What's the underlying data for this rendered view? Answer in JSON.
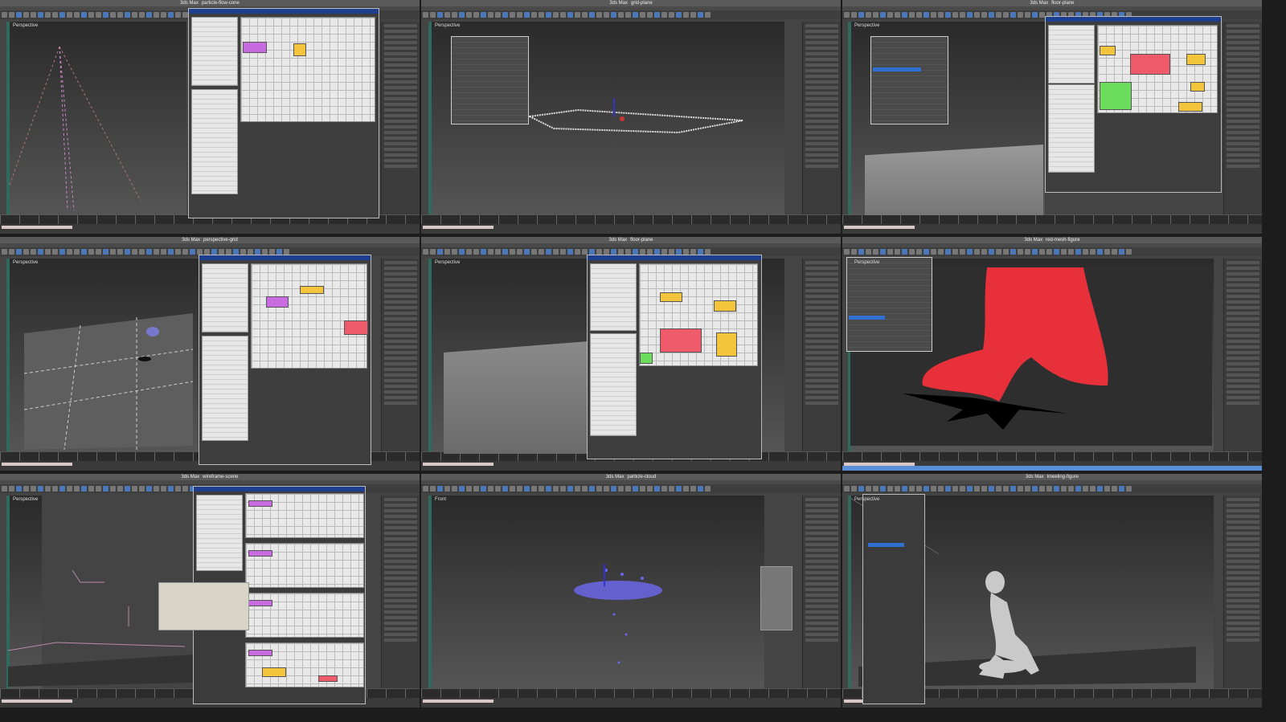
{
  "app": {
    "name": "3ds Max"
  },
  "grid": {
    "columns": 3,
    "rows": 3
  },
  "colors": {
    "viewport_top": "#2a2a2a",
    "viewport_bottom": "#555555",
    "node_purple": "#c86be0",
    "node_yellow": "#f2c53d",
    "node_red": "#ee5a6a",
    "node_green": "#6bdc5c",
    "mesh_red": "#e8303a",
    "particles_blue": "#6b66e8",
    "figure_gray": "#c9c9c9"
  },
  "tiles": [
    {
      "view": "Perspective",
      "content": "particle-flow-cone"
    },
    {
      "view": "Perspective",
      "content": "grid-plane"
    },
    {
      "view": "Perspective",
      "content": "floor-plane"
    },
    {
      "view": "Perspective",
      "content": "perspective-grid"
    },
    {
      "view": "Perspective",
      "content": "floor-plane"
    },
    {
      "view": "Perspective",
      "content": "red-mesh-figure"
    },
    {
      "view": "Perspective",
      "content": "wireframe-scene"
    },
    {
      "view": "Front",
      "content": "particle-cloud"
    },
    {
      "view": "Perspective",
      "content": "kneeling-figure"
    }
  ]
}
